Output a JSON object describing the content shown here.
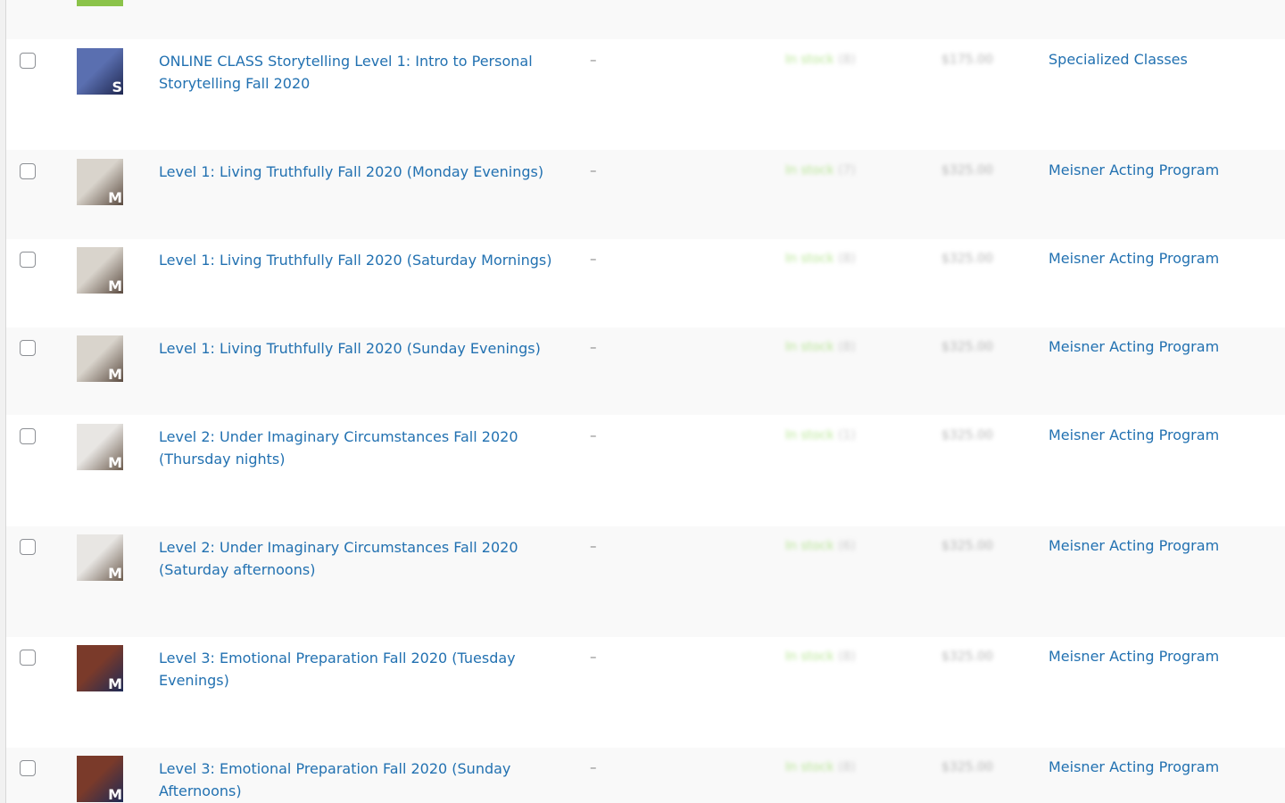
{
  "rows": [
    {
      "name": "ONLINE CLASS Storytelling Level 1: Intro to Personal Storytelling Fall 2020",
      "sku": "–",
      "stock_label": "In stock",
      "stock_count": "(8)",
      "price": "$175.00",
      "category": "Specialized Classes",
      "thumb_letter": "S",
      "thumb_colors": [
        "#5a6fb0",
        "#1f2750"
      ]
    },
    {
      "name": "Level 1: Living Truthfully Fall 2020 (Monday Evenings)",
      "sku": "–",
      "stock_label": "In stock",
      "stock_count": "(7)",
      "price": "$325.00",
      "category": "Meisner Acting Program",
      "thumb_letter": "M",
      "thumb_colors": [
        "#d9d4cc",
        "#5a4a3f"
      ]
    },
    {
      "name": "Level 1: Living Truthfully Fall 2020 (Saturday Mornings)",
      "sku": "–",
      "stock_label": "In stock",
      "stock_count": "(8)",
      "price": "$325.00",
      "category": "Meisner Acting Program",
      "thumb_letter": "M",
      "thumb_colors": [
        "#d9d4cc",
        "#5a4a3f"
      ]
    },
    {
      "name": "Level 1: Living Truthfully Fall 2020 (Sunday Evenings)",
      "sku": "–",
      "stock_label": "In stock",
      "stock_count": "(8)",
      "price": "$325.00",
      "category": "Meisner Acting Program",
      "thumb_letter": "M",
      "thumb_colors": [
        "#d9d4cc",
        "#5a4a3f"
      ]
    },
    {
      "name": "Level 2: Under Imaginary Circumstances Fall 2020 (Thursday nights)",
      "sku": "–",
      "stock_label": "In stock",
      "stock_count": "(1)",
      "price": "$325.00",
      "category": "Meisner Acting Program",
      "thumb_letter": "M",
      "thumb_colors": [
        "#e8e6e3",
        "#6b5a4c"
      ]
    },
    {
      "name": "Level 2: Under Imaginary Circumstances Fall 2020 (Saturday afternoons)",
      "sku": "–",
      "stock_label": "In stock",
      "stock_count": "(6)",
      "price": "$325.00",
      "category": "Meisner Acting Program",
      "thumb_letter": "M",
      "thumb_colors": [
        "#e8e6e3",
        "#6b5a4c"
      ]
    },
    {
      "name": "Level 3: Emotional Preparation Fall 2020 (Tuesday Evenings)",
      "sku": "–",
      "stock_label": "In stock",
      "stock_count": "(8)",
      "price": "$325.00",
      "category": "Meisner Acting Program",
      "thumb_letter": "M",
      "thumb_colors": [
        "#7a3a2a",
        "#1e2a55"
      ]
    },
    {
      "name": "Level 3: Emotional Preparation Fall 2020 (Sunday Afternoons)",
      "sku": "–",
      "stock_label": "In stock",
      "stock_count": "(8)",
      "price": "$325.00",
      "category": "Meisner Acting Program",
      "thumb_letter": "M",
      "thumb_colors": [
        "#7a3a2a",
        "#1e2a55"
      ]
    }
  ]
}
